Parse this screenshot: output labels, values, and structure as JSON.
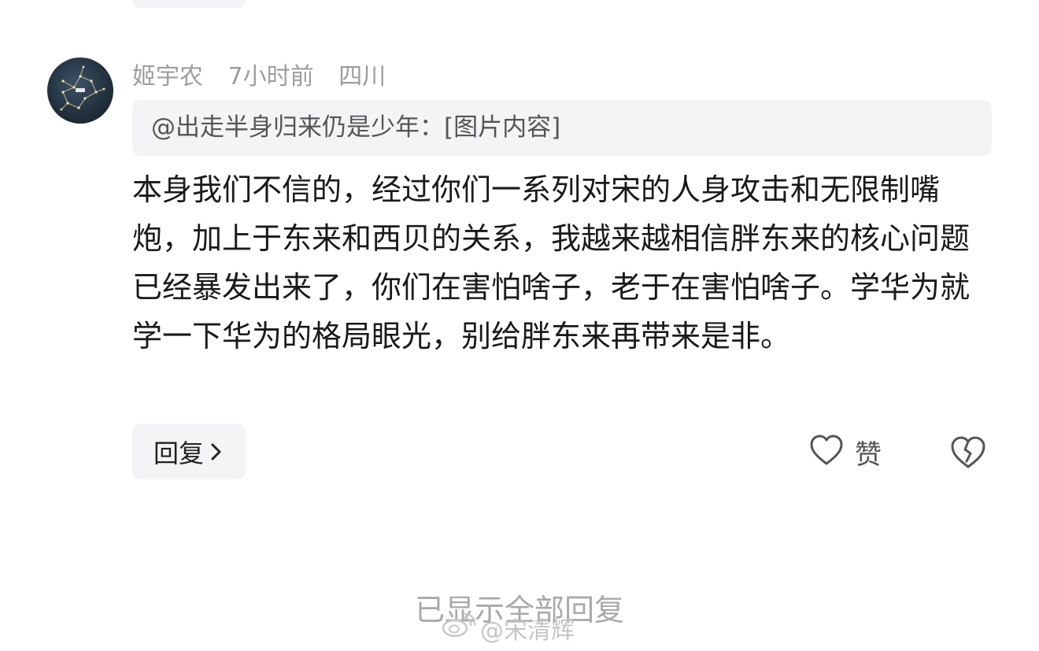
{
  "comment": {
    "author": "姬宇农",
    "time": "7小时前",
    "location": "四川",
    "quote": "@出走半身归来仍是少年：[图片内容]",
    "body": "本身我们不信的，经过你们一系列对宋的人身攻击和无限制嘴炮，加上于东来和西贝的关系，我越来越相信胖东来的核心问题已经暴发出来了，你们在害怕啥子，老于在害怕啥子。学华为就学一下华为的格局眼光，别给胖东来再带来是非。",
    "reply_label": "回复",
    "like_label": "赞"
  },
  "footer": {
    "all_replies_shown": "已显示全部回复"
  },
  "watermark": {
    "text": "@宋清辉"
  },
  "icons": {
    "avatar": "constellation-avatar",
    "reply_chevron": "chevron-right-icon",
    "like": "heart-outline-icon",
    "dislike": "broken-heart-icon",
    "watermark": "weibo-logo-icon"
  },
  "colors": {
    "background": "#ffffff",
    "meta_text": "#9d9d9d",
    "pill_background": "#f4f4f6",
    "body_text": "#1a1a1a"
  }
}
